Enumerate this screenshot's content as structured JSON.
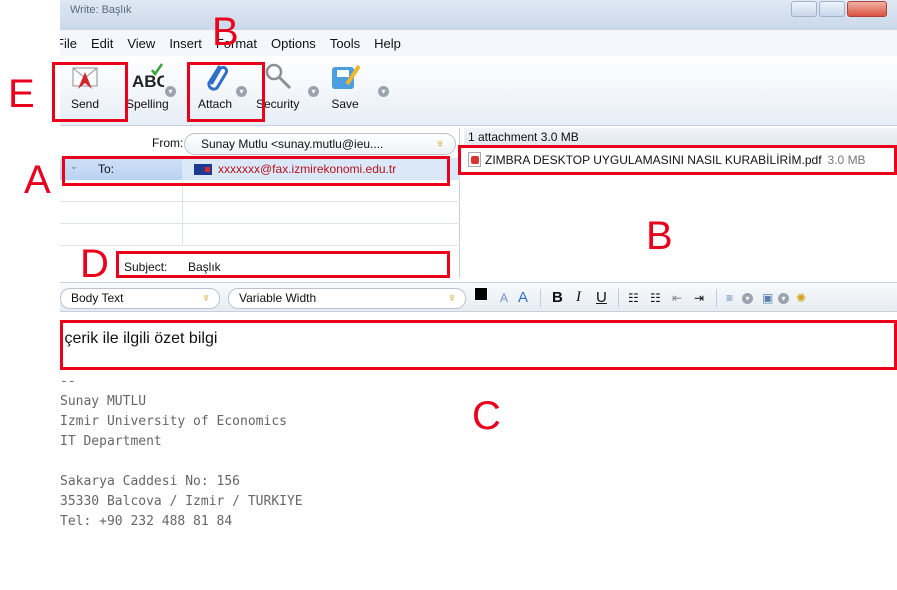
{
  "window": {
    "title": "Write: Başlık"
  },
  "menu": [
    "File",
    "Edit",
    "View",
    "Insert",
    "Format",
    "Options",
    "Tools",
    "Help"
  ],
  "toolbar": {
    "send": "Send",
    "spelling": "Spelling",
    "attach": "Attach",
    "security": "Security",
    "save": "Save"
  },
  "header": {
    "from_label": "From:",
    "from_value": "Sunay Mutlu <sunay.mutlu@ieu....",
    "to_label": "To:",
    "to_value": "xxxxxxx@fax.izmirekonomi.edu.tr",
    "subject_label": "Subject:",
    "subject_value": "Başlık"
  },
  "attachments": {
    "summary": "1 attachment  3.0 MB",
    "items": [
      {
        "name": "ZIMBRA DESKTOP UYGULAMASINI NASIL KURABİLİRİM.pdf",
        "size": "3.0 MB"
      }
    ]
  },
  "format": {
    "paragraph_style": "Body Text",
    "font": "Variable Width"
  },
  "body": {
    "text": "İçerik ile ilgili özet bilgi",
    "signature": "--\nSunay MUTLU\nIzmir University of Economics\nIT Department\n\nSakarya Caddesi No: 156\n35330 Balcova / Izmir / TURKIYE\nTel: +90 232 488 81 84"
  },
  "annotations": {
    "a": "A",
    "b_top": "B",
    "b_attach": "B",
    "c": "C",
    "d": "D",
    "e": "E"
  },
  "colors": {
    "annotation_red": "#e8001c",
    "recipient_red": "#b5131f"
  }
}
